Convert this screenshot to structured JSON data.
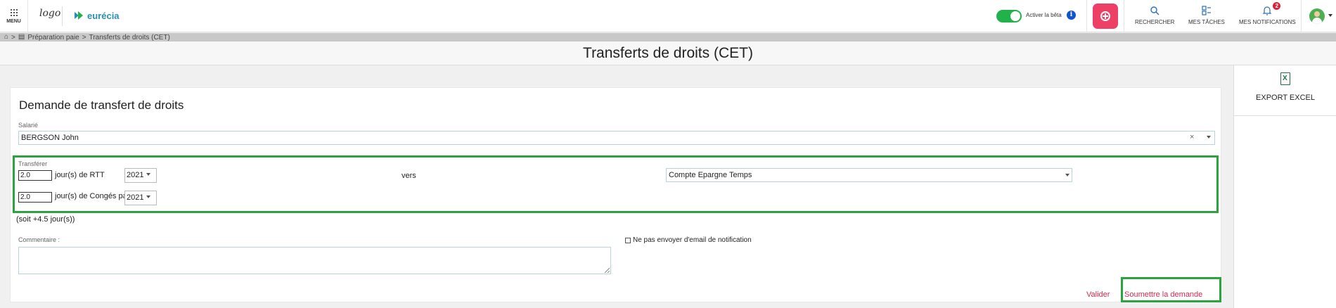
{
  "topbar": {
    "menu_label": "MENU",
    "logo_text": "logo",
    "brand_name": "eurécia",
    "beta_label": "Activer la bêta",
    "beta_enabled": true,
    "info_symbol": "i",
    "actions": [
      {
        "label": "RECHERCHER",
        "icon": "search-icon"
      },
      {
        "label": "MES TÂCHES",
        "icon": "tasks-icon"
      },
      {
        "label": "MES NOTIFICATIONS",
        "icon": "bell-icon",
        "badge": "2"
      }
    ],
    "add_icon": "plus-circle-icon"
  },
  "breadcrumb": {
    "home_icon": "home-icon",
    "separator": ">",
    "section_icon": "document-icon",
    "items": [
      "Préparation paie",
      "Transferts de droits (CET)"
    ]
  },
  "page": {
    "title": "Transferts de droits (CET)"
  },
  "right_panel": {
    "export_label": "EXPORT EXCEL",
    "export_icon": "excel-icon"
  },
  "form": {
    "title": "Demande de transfert de droits",
    "salarie_label": "Salarié",
    "salarie_value": "BERGSON John",
    "clear_symbol": "×",
    "transferer_label": "Transférer",
    "rows": [
      {
        "amount": "2.0",
        "unit_label": "jour(s) de RTT",
        "year": "2021"
      },
      {
        "amount": "2.0",
        "unit_label": "jour(s) de Congés payés",
        "year": "2021"
      }
    ],
    "vers_label": "vers",
    "destination": "Compte Epargne Temps",
    "total_text": "(soit +4.5 jour(s))",
    "commentaire_label": "Commentaire :",
    "commentaire_value": "",
    "no_email_label": "Ne pas envoyer d'email de notification",
    "no_email_checked": false,
    "valider_label": "Valider",
    "soumettre_label": "Soumettre la demande"
  },
  "colors": {
    "accent_pink": "#ee3f67",
    "toggle_green": "#21b24b",
    "highlight_green": "#2ba33f",
    "link_red": "#d52b4f",
    "brand_blue": "#2a8fb5"
  }
}
